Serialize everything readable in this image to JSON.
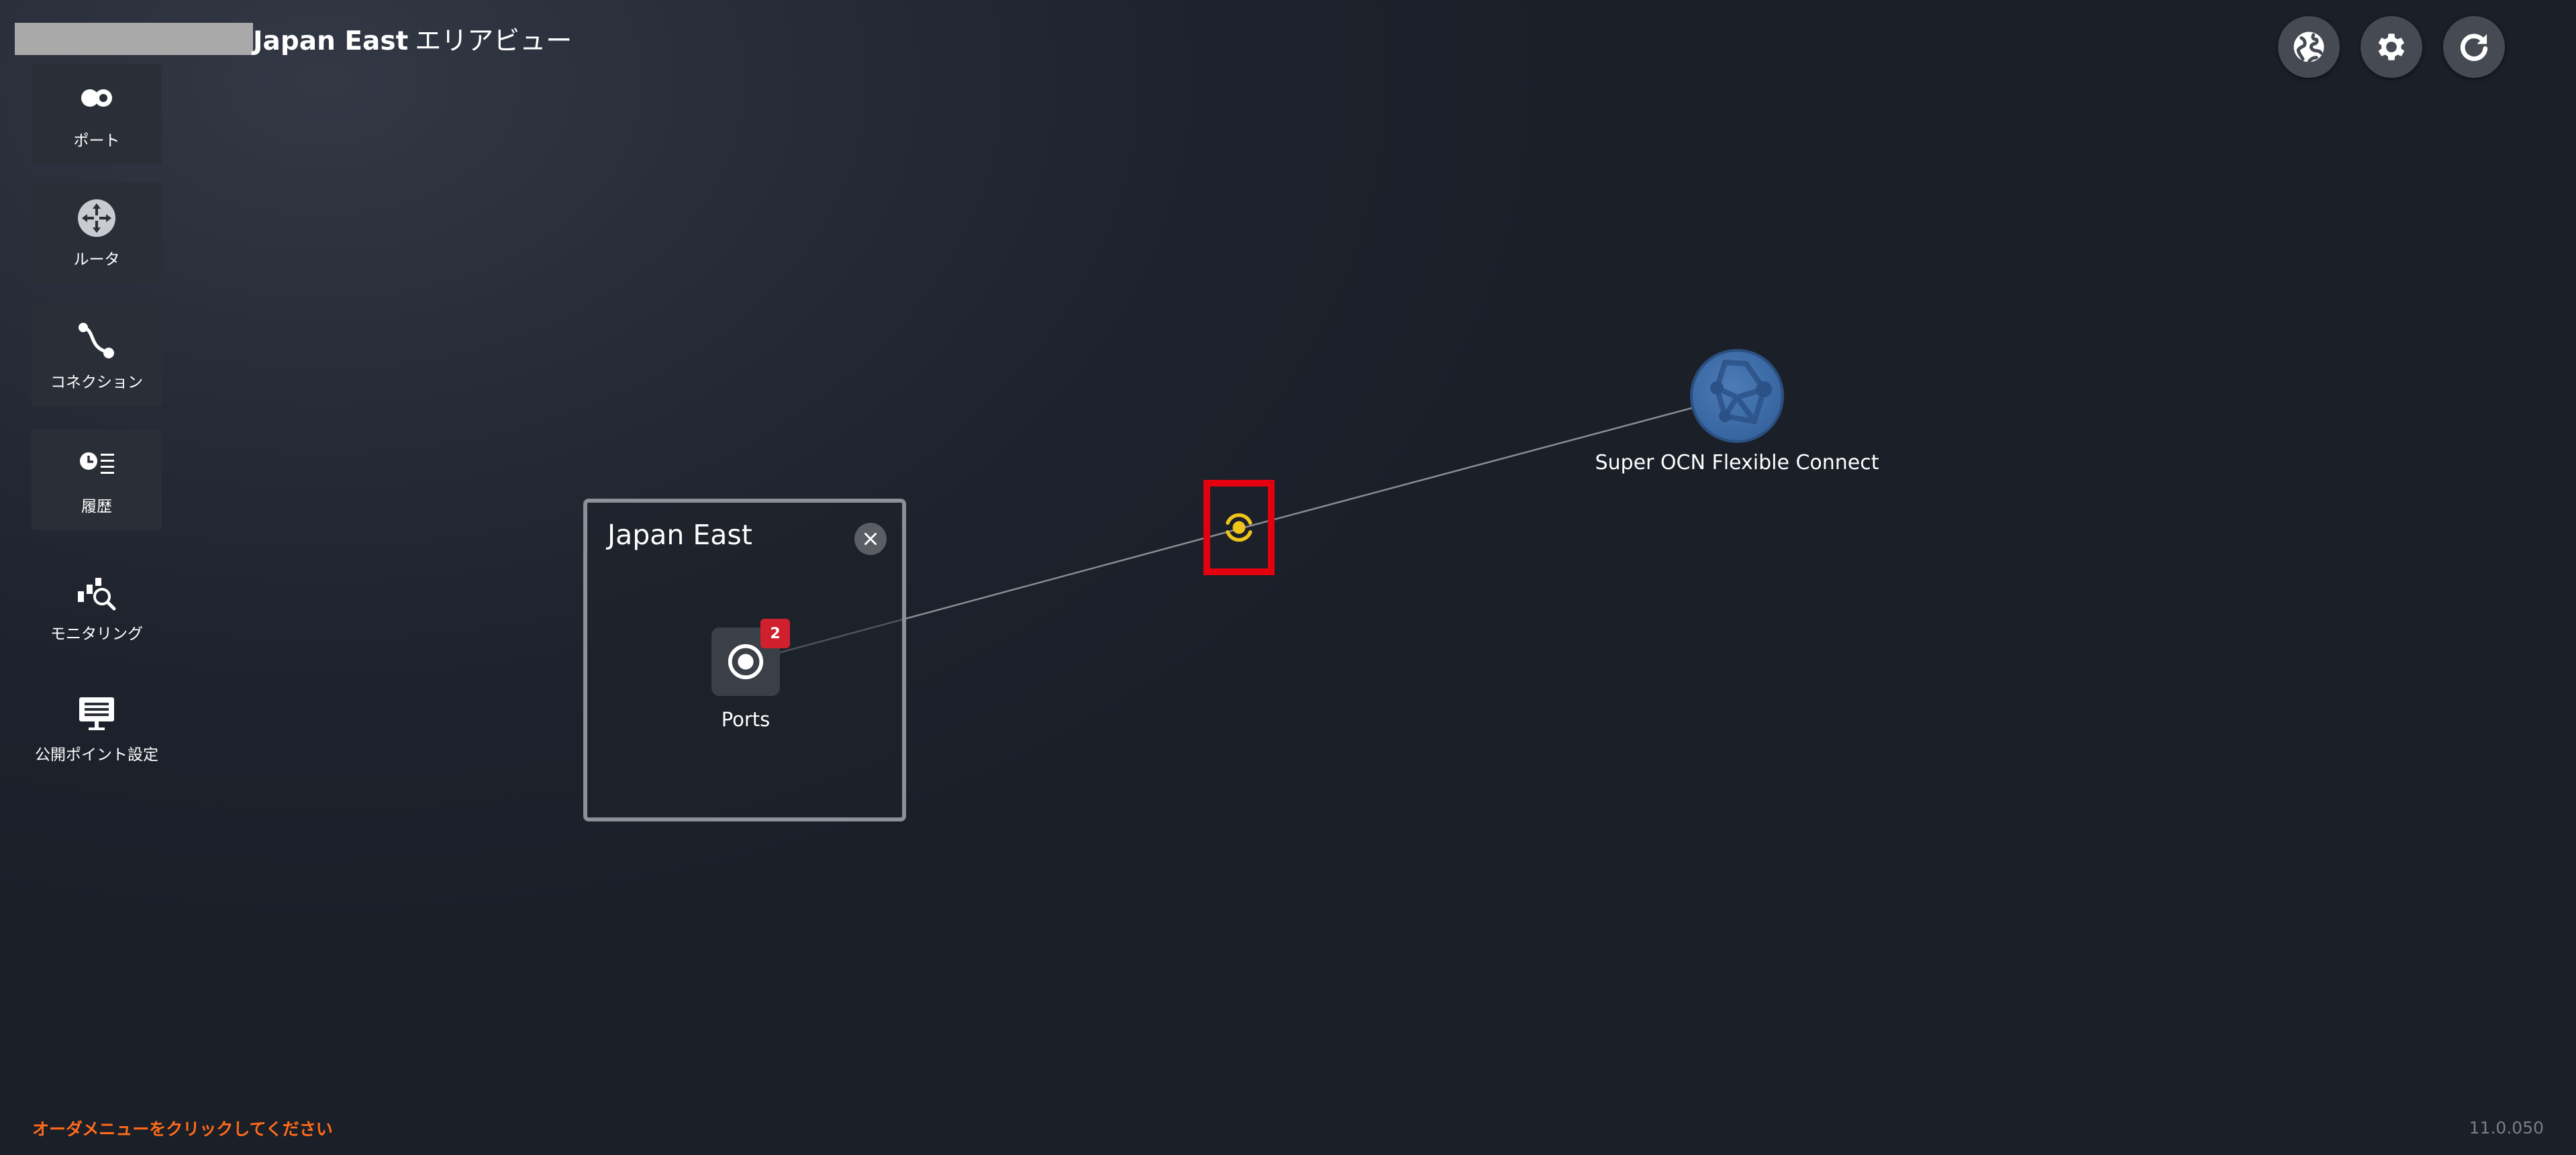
{
  "header": {
    "title": "Japan East",
    "subtitle": "エリアビュー"
  },
  "top_buttons": [
    {
      "name": "globe-button",
      "icon": "globe-icon"
    },
    {
      "name": "settings-button",
      "icon": "gear-icon"
    },
    {
      "name": "refresh-button",
      "icon": "refresh-icon"
    }
  ],
  "sidebar": {
    "items": [
      {
        "label": "ポート",
        "icon": "port-icon"
      },
      {
        "label": "ルータ",
        "icon": "router-icon"
      },
      {
        "label": "コネクション",
        "icon": "connection-icon"
      },
      {
        "label": "履歴",
        "icon": "history-icon"
      },
      {
        "label": "モニタリング",
        "icon": "monitoring-icon"
      },
      {
        "label": "公開ポイント設定",
        "icon": "public-point-icon"
      }
    ]
  },
  "area": {
    "title": "Japan East",
    "ports_label": "Ports",
    "ports_count": "2"
  },
  "cloud": {
    "label": "Super OCN Flexible Connect"
  },
  "footer": {
    "message": "オーダメニューをクリックしてください",
    "version": "11.0.050"
  },
  "colors": {
    "accent_red": "#e3000f",
    "connection_yellow": "#f0c419",
    "badge_red": "#d0202e",
    "status_orange": "#ff6a1a"
  }
}
